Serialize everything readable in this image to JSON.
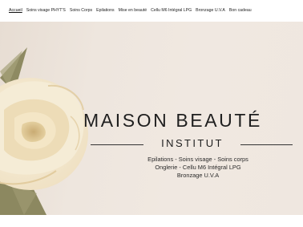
{
  "nav": {
    "items": [
      {
        "label": "Accueil",
        "active": true
      },
      {
        "label": "Soins visage PHYT'S",
        "active": false
      },
      {
        "label": "Soins Corps",
        "active": false
      },
      {
        "label": "Epilations",
        "active": false
      },
      {
        "label": "Mise en beauté",
        "active": false
      },
      {
        "label": "Cellu M6 Intégral LPG",
        "active": false
      },
      {
        "label": "Bronzage U.V.A",
        "active": false
      },
      {
        "label": "Bon cadeau",
        "active": false
      }
    ]
  },
  "hero": {
    "title": "MAISON BEAUTÉ",
    "subtitle": "INSTITUT",
    "services": [
      "Epilations - Soins visage - Soins corps",
      "Onglerie - Cellu M6 Intégral LPG",
      "Bronzage U.V.A"
    ]
  },
  "colors": {
    "background": "#f0e8e1",
    "text": "#1f1f1f",
    "flower": "#f3e9d2"
  }
}
